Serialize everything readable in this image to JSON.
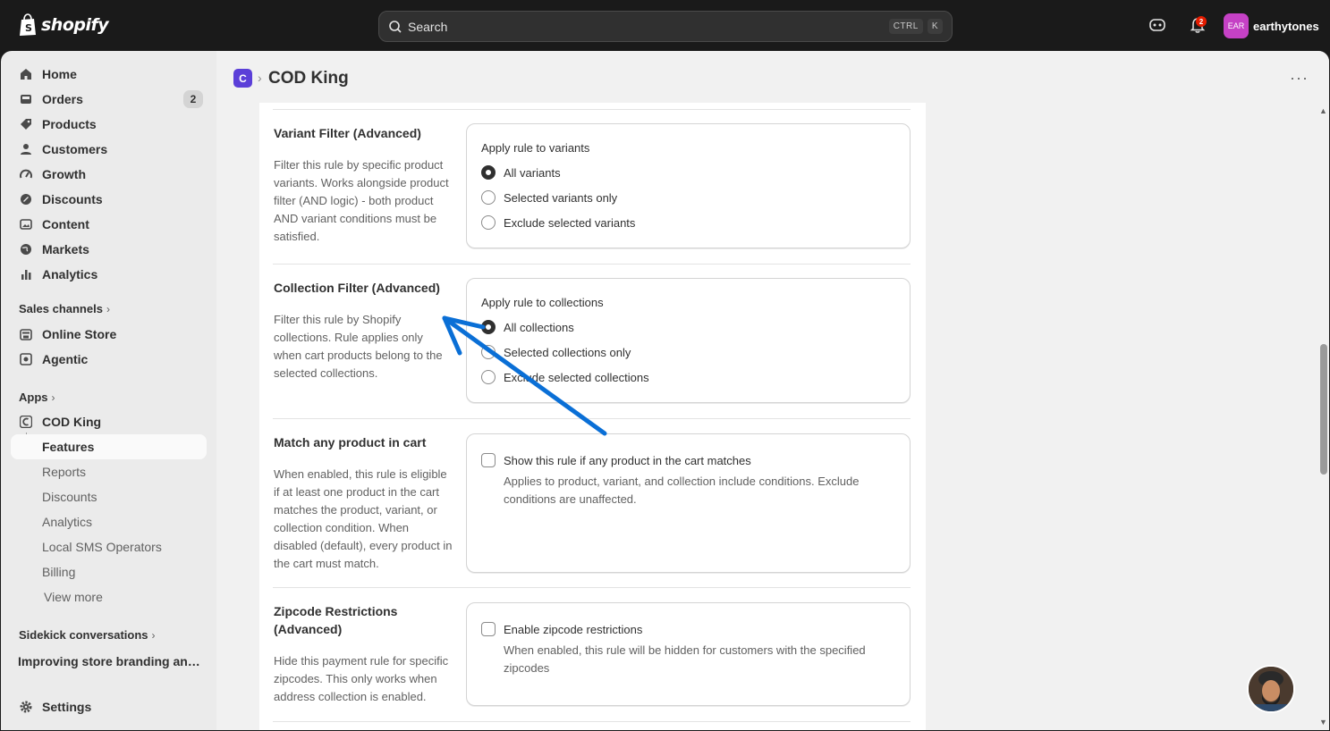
{
  "topbar": {
    "brand": "shopify",
    "search_placeholder": "Search",
    "shortcut_ctrl": "CTRL",
    "shortcut_k": "K",
    "notification_count": "2",
    "store_initials": "EAR",
    "store_name": "earthytones"
  },
  "sidebar": {
    "items": [
      {
        "label": "Home"
      },
      {
        "label": "Orders",
        "badge": "2"
      },
      {
        "label": "Products"
      },
      {
        "label": "Customers"
      },
      {
        "label": "Growth"
      },
      {
        "label": "Discounts"
      },
      {
        "label": "Content"
      },
      {
        "label": "Markets"
      },
      {
        "label": "Analytics"
      }
    ],
    "sales_channels_heading": "Sales channels",
    "sales_channels": [
      {
        "label": "Online Store"
      },
      {
        "label": "Agentic"
      }
    ],
    "apps_heading": "Apps",
    "app": {
      "label": "COD King"
    },
    "app_subitems": [
      {
        "label": "Features"
      },
      {
        "label": "Reports"
      },
      {
        "label": "Discounts"
      },
      {
        "label": "Analytics"
      },
      {
        "label": "Local SMS Operators"
      },
      {
        "label": "Billing"
      },
      {
        "label": "View more"
      }
    ],
    "sidekick_heading": "Sidekick conversations",
    "conversation": "Improving store branding and f...",
    "settings": "Settings"
  },
  "page": {
    "breadcrumb_sep": "›",
    "title": "COD King",
    "more": "···"
  },
  "sections": {
    "variant": {
      "title": "Variant Filter (Advanced)",
      "desc": "Filter this rule by specific product variants. Works alongside product filter (AND logic) - both product AND variant conditions must be satisfied.",
      "label": "Apply rule to variants",
      "options": [
        "All variants",
        "Selected variants only",
        "Exclude selected variants"
      ]
    },
    "collection": {
      "title": "Collection Filter (Advanced)",
      "desc": "Filter this rule by Shopify collections. Rule applies only when cart products belong to the selected collections.",
      "label": "Apply rule to collections",
      "options": [
        "All collections",
        "Selected collections only",
        "Exclude selected collections"
      ]
    },
    "match": {
      "title": "Match any product in cart",
      "desc": "When enabled, this rule is eligible if at least one product in the cart matches the product, variant, or collection condition. When disabled (default), every product in the cart must match.",
      "checkbox": "Show this rule if any product in the cart matches",
      "help": "Applies to product, variant, and collection include conditions. Exclude conditions are unaffected."
    },
    "zipcode": {
      "title": "Zipcode Restrictions (Advanced)",
      "desc": "Hide this payment rule for specific zipcodes. This only works when address collection is enabled.",
      "checkbox": "Enable zipcode restrictions",
      "help": "When enabled, this rule will be hidden for customers with the specified zipcodes"
    }
  },
  "colors": {
    "accent_app": "#5b3fd8",
    "store_avatar": "#c541c5",
    "annotation_arrow": "#0a6fd6"
  }
}
